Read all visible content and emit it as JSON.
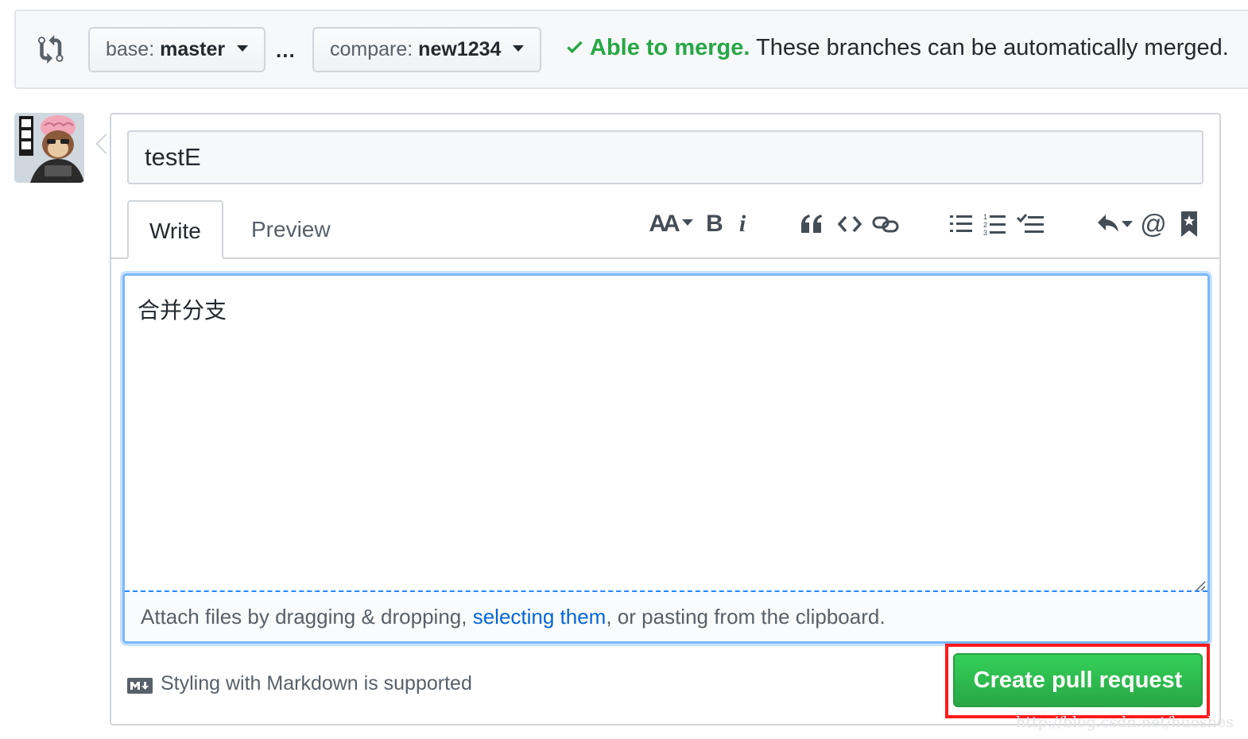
{
  "compare_bar": {
    "base_label": "base:",
    "base_branch": "master",
    "separator": "...",
    "compare_label": "compare:",
    "compare_branch": "new1234",
    "merge_ok": "Able to merge.",
    "merge_message": "These branches can be automatically merged."
  },
  "form": {
    "title_value": "testE",
    "tabs": [
      {
        "label": "Write",
        "active": true
      },
      {
        "label": "Preview",
        "active": false
      }
    ],
    "toolbar": {
      "header_label": "AA",
      "bold_label": "B",
      "italic_label": "i",
      "mention_label": "@"
    },
    "body_value": "合并分支",
    "attach": {
      "prefix": "Attach files by dragging & dropping, ",
      "link": "selecting them",
      "suffix": ", or pasting from the clipboard."
    },
    "markdown_hint": "Styling with Markdown is supported",
    "submit_label": "Create pull request"
  },
  "watermark": "http://blog.csdn.net/huoshes",
  "colors": {
    "success_green": "#28a745",
    "link_blue": "#0366d6",
    "focus_blue": "#79b8ff",
    "highlight_red": "#ff1a1a"
  },
  "icons": [
    "git-compare-icon",
    "check-icon",
    "caret-down-icon",
    "text-size-icon",
    "bold-icon",
    "italic-icon",
    "quote-icon",
    "code-icon",
    "link-icon",
    "unordered-list-icon",
    "ordered-list-icon",
    "task-list-icon",
    "reply-icon",
    "mention-icon",
    "bookmark-icon",
    "markdown-icon",
    "resize-grip-icon"
  ]
}
